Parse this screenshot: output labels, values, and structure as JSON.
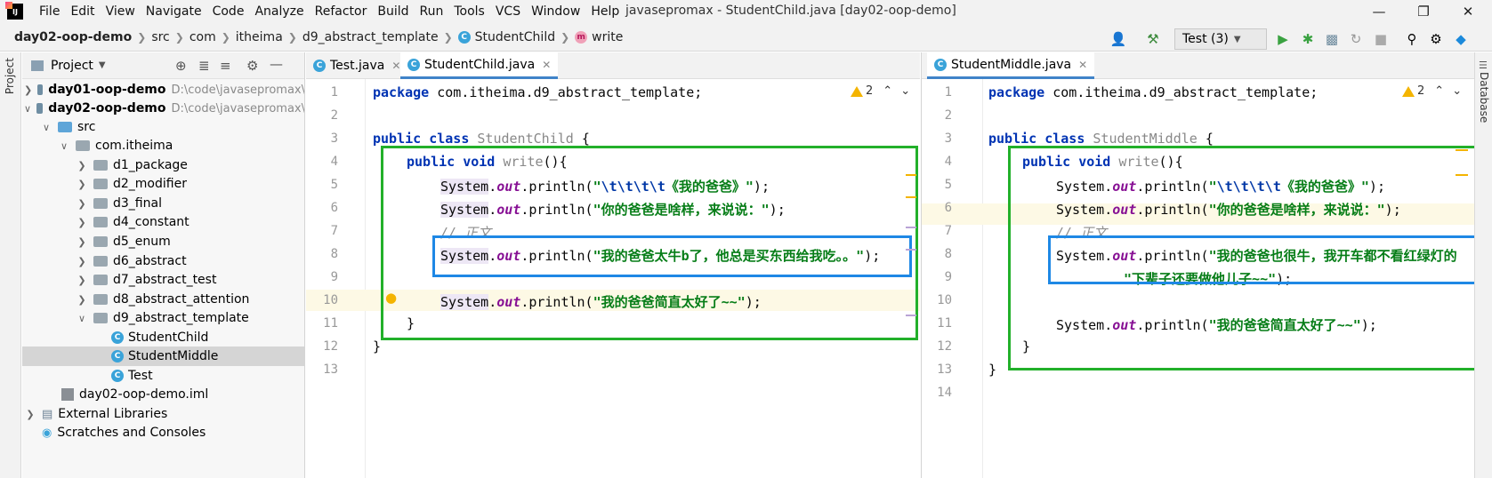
{
  "menu": [
    "File",
    "Edit",
    "View",
    "Navigate",
    "Code",
    "Analyze",
    "Refactor",
    "Build",
    "Run",
    "Tools",
    "VCS",
    "Window",
    "Help"
  ],
  "window_title": "javasepromax - StudentChild.java [day02-oop-demo]",
  "breadcrumb": [
    "day02-oop-demo",
    "src",
    "com",
    "itheima",
    "d9_abstract_template",
    "StudentChild",
    "write"
  ],
  "run_config": "Test (3)",
  "left_stripe_label": "Project",
  "right_stripe_label": "Database",
  "project": {
    "title": "Project",
    "rows": [
      {
        "label": "day01-oop-demo",
        "path": "D:\\code\\javasepromax\\"
      },
      {
        "label": "day02-oop-demo",
        "path": "D:\\code\\javasepromax\\"
      },
      {
        "label": "src"
      },
      {
        "label": "com.itheima"
      },
      {
        "label": "d1_package"
      },
      {
        "label": "d2_modifier"
      },
      {
        "label": "d3_final"
      },
      {
        "label": "d4_constant"
      },
      {
        "label": "d5_enum"
      },
      {
        "label": "d6_abstract"
      },
      {
        "label": "d7_abstract_test"
      },
      {
        "label": "d8_abstract_attention"
      },
      {
        "label": "d9_abstract_template"
      },
      {
        "label": "StudentChild"
      },
      {
        "label": "StudentMiddle"
      },
      {
        "label": "Test"
      },
      {
        "label": "day02-oop-demo.iml"
      },
      {
        "label": "External Libraries"
      },
      {
        "label": "Scratches and Consoles"
      }
    ]
  },
  "left_editor": {
    "tabs": [
      "Test.java",
      "StudentChild.java"
    ],
    "warning_count": "2",
    "line_numbers": [
      "1",
      "2",
      "3",
      "4",
      "5",
      "6",
      "7",
      "8",
      "9",
      "10",
      "11",
      "12",
      "13"
    ],
    "code": {
      "package_kw": "package",
      "package_name": "com.itheima.d9_abstract_template;",
      "public_kw": "public",
      "class_kw": "class",
      "class_name": "StudentChild",
      "open_brace": "{",
      "void_kw": "void",
      "method": "write",
      "method_tail": "(){",
      "system": "System",
      "out": "out",
      "println": ".println(",
      "str1_esc": "\\t\\t\\t\\t",
      "str1": "《我的爸爸》",
      "str2": "你的爸爸是啥样，来说说：",
      "comment": "// 正文",
      "str3": "我的爸爸太牛b了，他总是买东西给我吃。。",
      "str4": "我的爸爸简直太好了~~",
      "close_call": ");",
      "close_brace": "}"
    }
  },
  "right_editor": {
    "tabs": [
      "StudentMiddle.java"
    ],
    "warning_count": "2",
    "line_numbers": [
      "1",
      "2",
      "3",
      "4",
      "5",
      "6",
      "7",
      "8",
      "9",
      "10",
      "11",
      "12",
      "13",
      "14"
    ],
    "code": {
      "class_name": "StudentMiddle",
      "str3": "我的爸爸也很牛，我开车都不看红绿灯的",
      "str3b": "下辈子还要做他儿子~~"
    }
  },
  "colors": {
    "green_box": "#22b02a",
    "blue_box": "#1e88e5"
  }
}
